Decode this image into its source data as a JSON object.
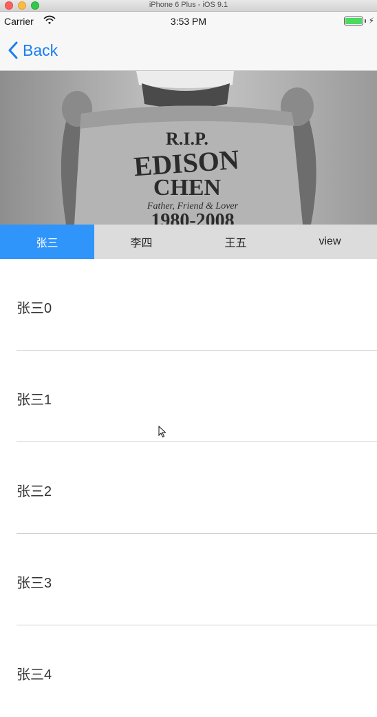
{
  "window": {
    "title": "iPhone 6 Plus - iOS 9.1"
  },
  "status_bar": {
    "carrier": "Carrier",
    "time": "3:53 PM",
    "battery_level": 1.0
  },
  "nav": {
    "back_label": "Back"
  },
  "hero": {
    "shirt_lines": [
      "R.I.P.",
      "EDISON",
      "CHEN",
      "Father, Friend & Lover",
      "1980-2008"
    ]
  },
  "tabs": [
    {
      "label": "张三",
      "active": true
    },
    {
      "label": "李四",
      "active": false
    },
    {
      "label": "王五",
      "active": false
    },
    {
      "label": "view",
      "active": false
    }
  ],
  "list": {
    "items": [
      "张三0",
      "张三1",
      "张三2",
      "张三3",
      "张三4"
    ]
  },
  "colors": {
    "accent": "#1a7ef0",
    "active_tab": "#2f95fb",
    "tab_bar": "#dcdcdc"
  }
}
